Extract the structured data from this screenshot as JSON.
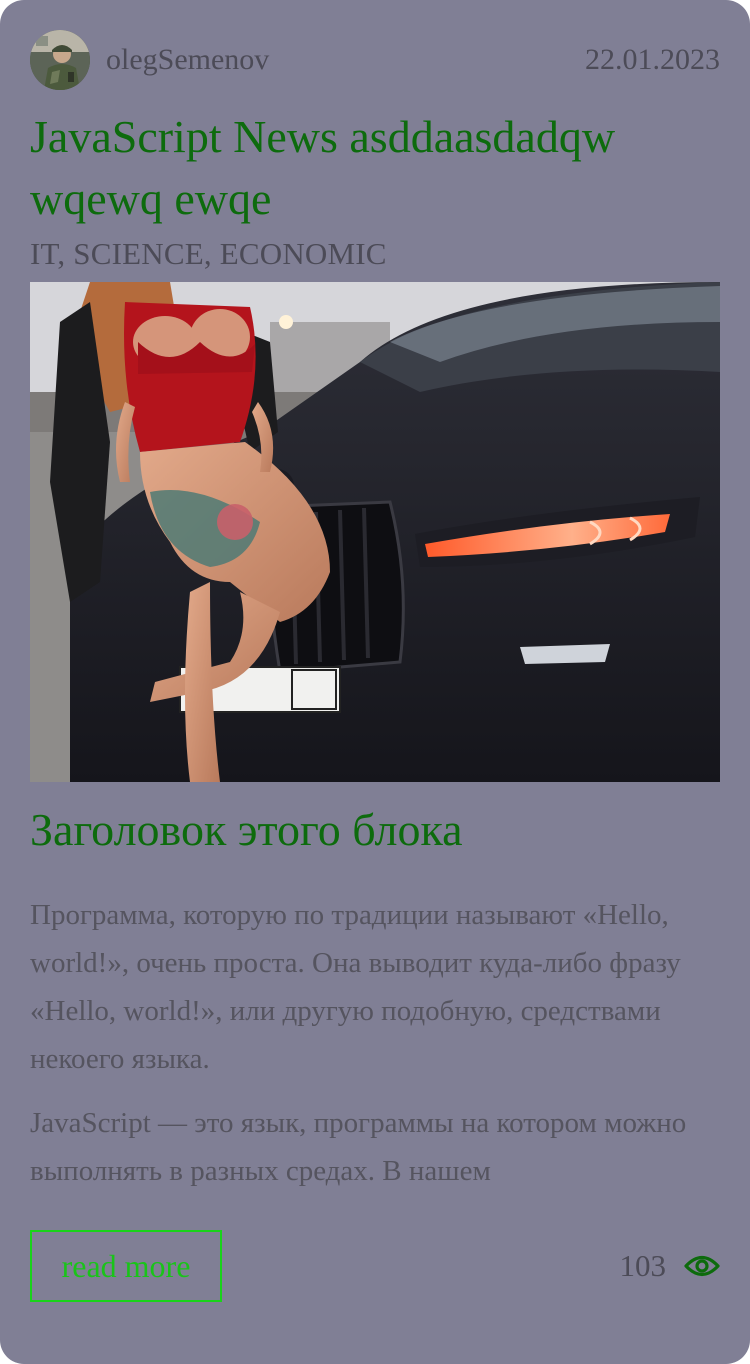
{
  "post": {
    "author": "olegSemenov",
    "date": "22.01.2023",
    "title": "JavaScript News asddaasdadqw wqewq ewqe",
    "tags": "IT, SCIENCE, ECONOMIC",
    "image_alt": "car",
    "block_title": "Заголовок этого блока",
    "paragraphs": [
      "Программа, которую по традиции называют «Hello, world!», очень проста. Она выводит куда-либо фразу «Hello, world!», или другую подобную, средствами некоего языка.",
      "JavaScript — это язык, программы на котором можно выполнять в разных средах. В нашем"
    ],
    "read_more_label": "read more",
    "views": "103",
    "views_icon": "eye-icon",
    "avatar_icon": "avatar"
  },
  "colors": {
    "card_background": "#807f95",
    "title_green": "#0d6b0d",
    "button_green": "#1ad31a",
    "muted_text": "#4c4b57"
  }
}
